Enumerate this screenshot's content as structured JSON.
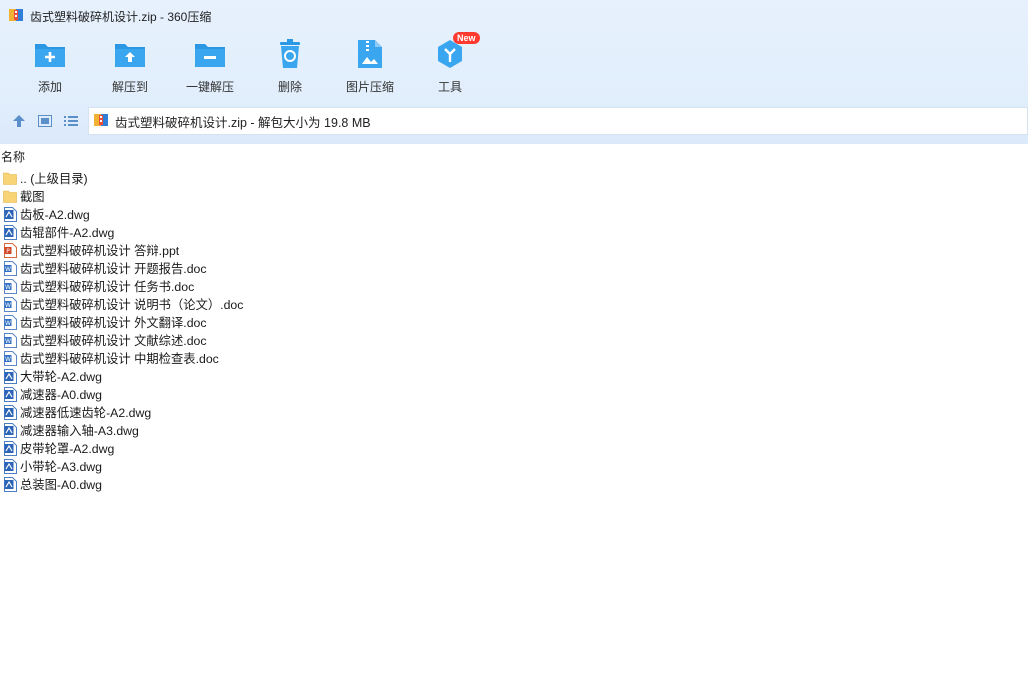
{
  "window": {
    "title": "齿式塑料破碎机设计.zip - 360压缩"
  },
  "toolbar": {
    "items": [
      {
        "label": "添加",
        "icon": "add-icon"
      },
      {
        "label": "解压到",
        "icon": "extract-to-icon"
      },
      {
        "label": "一键解压",
        "icon": "one-click-extract-icon"
      },
      {
        "label": "删除",
        "icon": "delete-icon"
      },
      {
        "label": "图片压缩",
        "icon": "image-compress-icon"
      },
      {
        "label": "工具",
        "icon": "tools-icon",
        "badge": "New"
      }
    ]
  },
  "address": {
    "text": "齿式塑料破碎机设计.zip - 解包大小为 19.8 MB"
  },
  "list_header": {
    "name": "名称"
  },
  "files": [
    {
      "name": ".. (上级目录)",
      "type": "folder"
    },
    {
      "name": "截图",
      "type": "folder"
    },
    {
      "name": "齿板-A2.dwg",
      "type": "dwg"
    },
    {
      "name": "齿辊部件-A2.dwg",
      "type": "dwg"
    },
    {
      "name": "齿式塑料破碎机设计 答辩.ppt",
      "type": "ppt"
    },
    {
      "name": "齿式塑料破碎机设计 开题报告.doc",
      "type": "doc"
    },
    {
      "name": "齿式塑料破碎机设计 任务书.doc",
      "type": "doc"
    },
    {
      "name": "齿式塑料破碎机设计 说明书（论文）.doc",
      "type": "doc"
    },
    {
      "name": "齿式塑料破碎机设计 外文翻译.doc",
      "type": "doc"
    },
    {
      "name": "齿式塑料破碎机设计 文献综述.doc",
      "type": "doc"
    },
    {
      "name": "齿式塑料破碎机设计 中期检查表.doc",
      "type": "doc"
    },
    {
      "name": "大带轮-A2.dwg",
      "type": "dwg"
    },
    {
      "name": "减速器-A0.dwg",
      "type": "dwg"
    },
    {
      "name": "减速器低速齿轮-A2.dwg",
      "type": "dwg"
    },
    {
      "name": "减速器输入轴-A3.dwg",
      "type": "dwg"
    },
    {
      "name": "皮带轮罩-A2.dwg",
      "type": "dwg"
    },
    {
      "name": "小带轮-A3.dwg",
      "type": "dwg"
    },
    {
      "name": "总装图-A0.dwg",
      "type": "dwg"
    }
  ],
  "colors": {
    "accent": "#2d9be8",
    "toolbar_bg": "#e3effc",
    "badge": "#ff3b30"
  }
}
